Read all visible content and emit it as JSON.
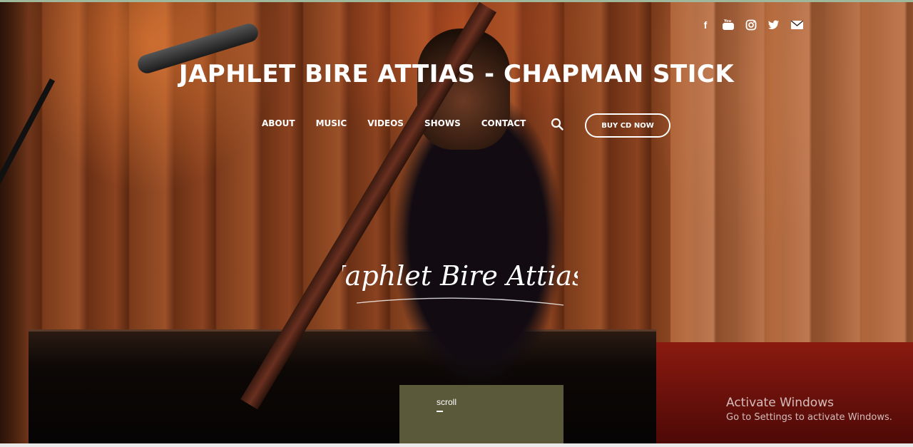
{
  "header": {
    "social_icons": [
      "facebook-icon",
      "youtube-icon",
      "instagram-icon",
      "twitter-icon",
      "email-icon"
    ],
    "title": "JAPHLET BIRE ATTIAS - CHAPMAN STICK"
  },
  "nav": {
    "items": [
      {
        "label": "ABOUT"
      },
      {
        "label": "MUSIC"
      },
      {
        "label": "VIDEOS"
      },
      {
        "label": "SHOWS"
      },
      {
        "label": "CONTACT"
      }
    ],
    "buy_label": "BUY CD NOW"
  },
  "hero": {
    "logo_text": "Japhlet Bire Attias",
    "scroll_label": "scroll"
  },
  "os_overlay": {
    "line1": "Activate Windows",
    "line2": "Go to Settings to activate Windows."
  },
  "colors": {
    "text": "#ffffff",
    "wood": "#8a4220",
    "accent_top": "#9fb79a"
  }
}
